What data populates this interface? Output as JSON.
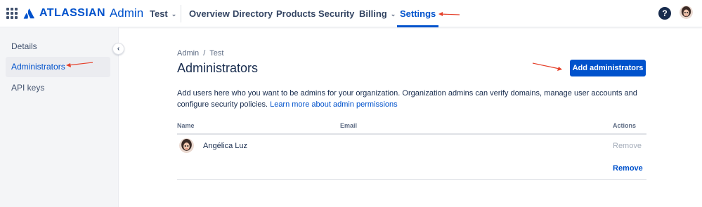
{
  "header": {
    "brand": "ATLASSIAN",
    "product": "Admin",
    "org_switcher": "Test",
    "nav": [
      {
        "label": "Overview",
        "active": false,
        "dropdown": false
      },
      {
        "label": "Directory",
        "active": false,
        "dropdown": false
      },
      {
        "label": "Products",
        "active": false,
        "dropdown": false
      },
      {
        "label": "Security",
        "active": false,
        "dropdown": false
      },
      {
        "label": "Billing",
        "active": false,
        "dropdown": true
      },
      {
        "label": "Settings",
        "active": true,
        "dropdown": false
      }
    ],
    "help_label": "?",
    "icons": [
      "app-switcher-icon",
      "atlassian-logo-icon",
      "help-icon",
      "user-avatar"
    ]
  },
  "sidebar": {
    "items": [
      {
        "label": "Details",
        "active": false
      },
      {
        "label": "Administrators",
        "active": true
      },
      {
        "label": "API keys",
        "active": false
      }
    ],
    "collapse_label": "‹"
  },
  "main": {
    "breadcrumb": [
      "Admin",
      "Test"
    ],
    "breadcrumb_separator": "/",
    "title": "Administrators",
    "add_button": "Add administrators",
    "description": "Add users here who you want to be admins for your organization. Organization admins can verify domains, manage user accounts and configure security policies.",
    "description_link": "Learn more about admin permissions",
    "table": {
      "columns": [
        "Name",
        "Email",
        "Actions"
      ],
      "rows": [
        {
          "name": "Angélica Luz",
          "email": "",
          "action": "Remove",
          "action_enabled": false
        }
      ],
      "footer_action": "Remove"
    }
  },
  "colors": {
    "accent": "#0052cc",
    "text": "#172b4d",
    "sidebar_bg": "#f4f5f7",
    "annotation": "#e5412b"
  }
}
